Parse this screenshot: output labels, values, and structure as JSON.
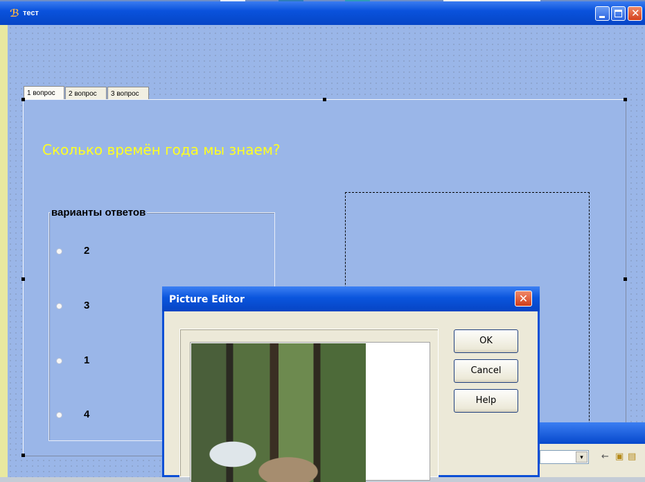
{
  "window": {
    "title": "тест",
    "title_icon": "app-icon"
  },
  "tabs": [
    {
      "label": "1 вопрос",
      "active": true
    },
    {
      "label": "2 вопрос",
      "active": false
    },
    {
      "label": "3 вопрос",
      "active": false
    }
  ],
  "page": {
    "question": "Сколько времён года мы знаем?",
    "answers_group": {
      "caption": "варианты ответов",
      "options": [
        "2",
        "3",
        "1",
        "4"
      ]
    }
  },
  "picture_editor": {
    "title": "Picture Editor",
    "buttons": {
      "ok": "OK",
      "cancel": "Cancel",
      "help": "Help"
    }
  },
  "colors": {
    "client_bg": "#9ab6e8",
    "question_text": "#ffff22",
    "titlebar": "#0a52dc"
  }
}
